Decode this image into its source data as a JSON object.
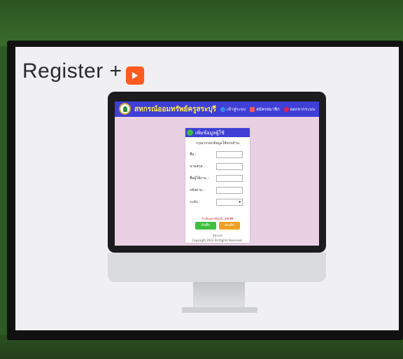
{
  "slide": {
    "title": "Register +"
  },
  "app": {
    "site_title": "สหกรณ์ออมทรัพย์ครูสระบุรี",
    "nav": [
      {
        "label": "เข้าสู่ระบบ",
        "color": "#3b8df0"
      },
      {
        "label": "สมัครสมาชิก",
        "color": "#f05a5a"
      },
      {
        "label": "ออกจากระบบ",
        "color": "#e02050"
      }
    ],
    "card": {
      "header": "เพิ่มข้อมูลผู้ใช้",
      "subtitle": "กรุณากรอกข้อมูลให้ครบถ้วน",
      "fields": [
        {
          "label": "ชื่อ :",
          "value": ""
        },
        {
          "label": "นามสกุล :",
          "value": ""
        },
        {
          "label": "ชื่อผู้ใช้งาน :",
          "value": ""
        },
        {
          "label": "รหัสผ่าน :",
          "value": ""
        }
      ],
      "select_label": "ระดับ :",
      "select_value": "",
      "login_hint": "ถ้าเป็นสมาชิกแล้ว คลิกที่นี่",
      "save_label": "บันทึก",
      "cancel_label": "ยกเลิก",
      "back_link": "หน้าแรก"
    },
    "footer": "Copyright 2023 All Rights Reserved"
  }
}
